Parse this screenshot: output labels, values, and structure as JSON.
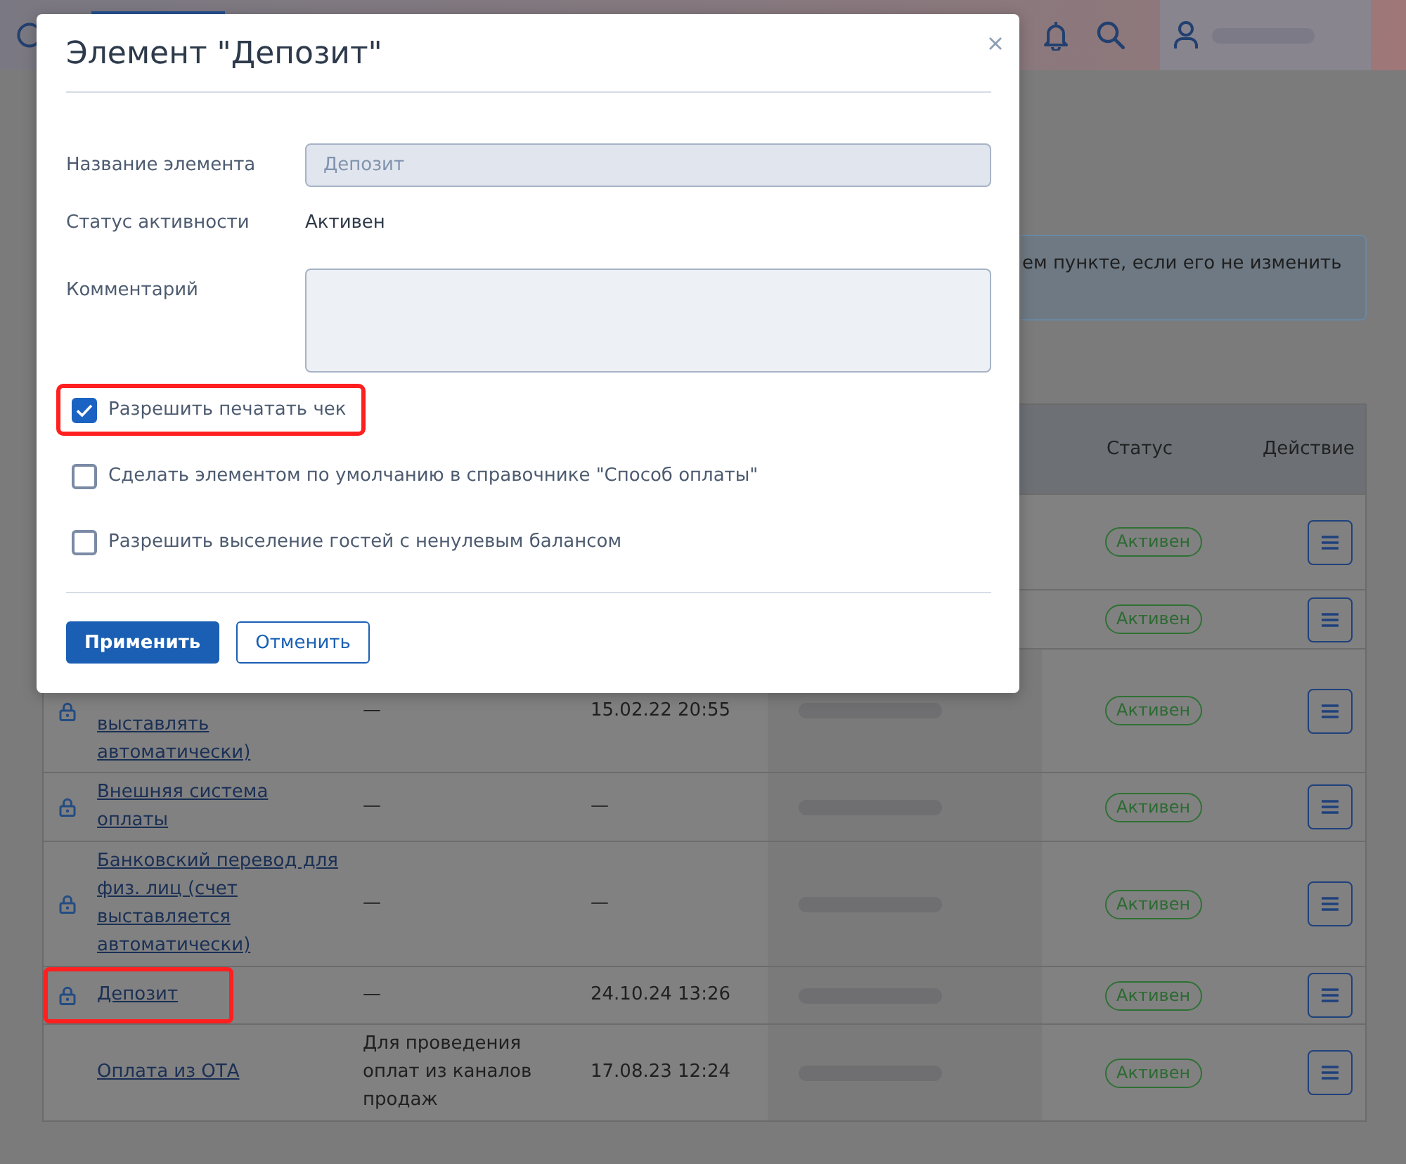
{
  "modal": {
    "title": "Элемент \"Депозит\"",
    "name_field": {
      "label": "Название элемента",
      "value": "Депозит",
      "disabled": true
    },
    "status_field": {
      "label": "Статус активности",
      "value": "Активен"
    },
    "comment_field": {
      "label": "Комментарий"
    },
    "checkboxes": [
      {
        "label": "Разрешить печатать чек",
        "checked": true,
        "highlighted": true
      },
      {
        "label": "Сделать элементом по умолчанию в справочнике \"Способ оплаты\"",
        "checked": false,
        "highlighted": false
      },
      {
        "label": "Разрешить выселение гостей с ненулевым балансом",
        "checked": false,
        "highlighted": false
      }
    ],
    "buttons": [
      {
        "label": "Применить",
        "kind": "primary"
      },
      {
        "label": "Отменить",
        "kind": "secondary"
      }
    ]
  },
  "info_banner": {
    "text": "ем пункте, если его не изменить"
  },
  "table": {
    "status_header": "Статус",
    "action_header": "Действие",
    "rows": [
      {
        "status": "Активен",
        "highlighted": false
      },
      {
        "status": "Активен",
        "highlighted": false
      },
      {
        "name": "выставлять автоматически)",
        "locked": true,
        "comment": "—",
        "date": "15.02.22 20:55",
        "user_blurred": true,
        "status": "Активен",
        "highlighted": false
      },
      {
        "name": "Внешняя система оплаты",
        "locked": true,
        "comment": "—",
        "date": "—",
        "user_blurred": true,
        "status": "Активен",
        "highlighted": false
      },
      {
        "name": "Банковский перевод для физ. лиц (счет выставляется автоматически)",
        "locked": true,
        "comment": "—",
        "date": "—",
        "user_blurred": true,
        "status": "Активен",
        "highlighted": false
      },
      {
        "name": "Депозит",
        "locked": true,
        "comment": "—",
        "date": "24.10.24 13:26",
        "user_blurred": true,
        "status": "Активен",
        "highlighted": true
      },
      {
        "name": "Оплата из ОТА",
        "locked": false,
        "comment": "Для проведения оплат из каналов продаж",
        "date": "17.08.23 12:24",
        "user_blurred": true,
        "status": "Активен",
        "highlighted": false
      }
    ]
  }
}
